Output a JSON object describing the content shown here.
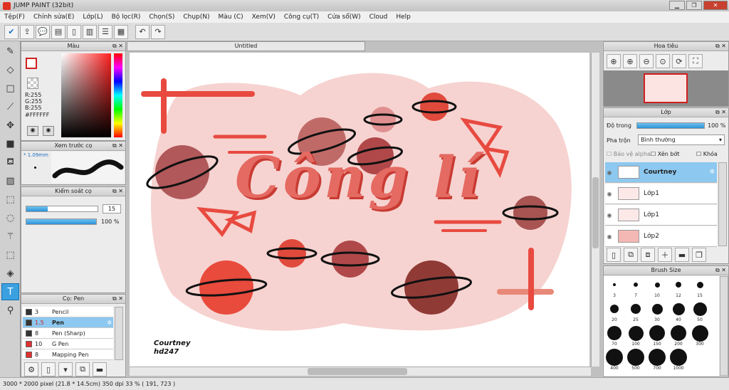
{
  "window": {
    "title": "JUMP PAINT (32bit)"
  },
  "menu": [
    "Tệp(F)",
    "Chỉnh sửa(E)",
    "Lớp(L)",
    "Bộ lọc(R)",
    "Chọn(S)",
    "Chụp(N)",
    "Màu (C)",
    "Xem(V)",
    "Công cụ(T)",
    "Cửa sổ(W)",
    "Cloud",
    "Help"
  ],
  "color_panel": {
    "title": "Màu",
    "r": "R:255",
    "g": "G:255",
    "b": "B:255",
    "hex": "#FFFFFF"
  },
  "brush_preview": {
    "title": "Xem trước cọ",
    "size": "* 1.09mm"
  },
  "brush_control": {
    "title": "Kiểm soát cọ",
    "size_value": "15",
    "opacity_value": "100 %",
    "size_fraction": 0.3,
    "opacity_fraction": 1.0
  },
  "brush_list": {
    "title": "Cọ: Pen",
    "items": [
      {
        "size": "3",
        "name": "Pencil",
        "color": "#333333"
      },
      {
        "size": "1.5",
        "name": "Pen",
        "color": "#333333",
        "selected": true
      },
      {
        "size": "8",
        "name": "Pen (Sharp)",
        "color": "#333333"
      },
      {
        "size": "10",
        "name": "G Pen",
        "color": "#e03030"
      },
      {
        "size": "8",
        "name": "Mapping Pen",
        "color": "#e03030"
      }
    ]
  },
  "document": {
    "tab": "Untitled"
  },
  "artwork": {
    "title": "Công lí",
    "signature_line1": "Courtney",
    "signature_line2": "hd247"
  },
  "navigator": {
    "title": "Hoa tiêu"
  },
  "layer_panel": {
    "title": "Lớp",
    "opacity_label": "Độ trong",
    "opacity_value": "100 %",
    "opacity_fraction": 1.0,
    "blend_label": "Pha trộn",
    "blend_value": "Bình thường",
    "protect_alpha": "Bảo vệ alpha",
    "clip": "Xén bớt",
    "lock": "Khóa",
    "layers": [
      {
        "name": "Courtney",
        "selected": true
      },
      {
        "name": "Lớp1"
      },
      {
        "name": "Lớp1"
      },
      {
        "name": "Lớp2"
      }
    ]
  },
  "brush_size": {
    "title": "Brush Size",
    "sizes": [
      "3",
      "7",
      "10",
      "12",
      "15",
      "20",
      "25",
      "30",
      "40",
      "50",
      "70",
      "100",
      "150",
      "200",
      "300",
      "400",
      "500",
      "700",
      "1000"
    ]
  },
  "status": {
    "text": "3000 * 2000 pixel   (21.8 * 14.5cm)  350 dpi  33 %  ( 191, 723 )"
  },
  "colors": {
    "accent": "#3aa0e0",
    "canvas_blob": "#f6d3d0",
    "planet_red": "#e04a3c",
    "planet_dark": "#8a3a34"
  }
}
